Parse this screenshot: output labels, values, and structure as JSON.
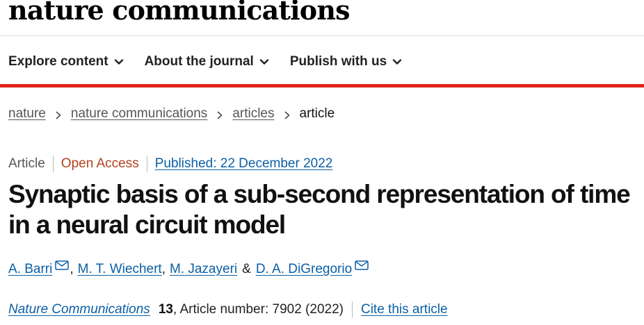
{
  "header": {
    "brand": "nature communications",
    "nav": [
      {
        "label": "Explore content"
      },
      {
        "label": "About the journal"
      },
      {
        "label": "Publish with us"
      }
    ]
  },
  "breadcrumb": {
    "items": [
      "nature",
      "nature communications",
      "articles"
    ],
    "current": "article"
  },
  "article": {
    "type": "Article",
    "access": "Open Access",
    "published": "Published: 22 December 2022",
    "title": "Synaptic basis of a sub-second representation of time in a neural circuit model",
    "authors": [
      "A. Barri",
      "M. T. Wiechert",
      "M. Jazayeri",
      "D. A. DiGregorio"
    ],
    "author_separator": ",",
    "author_and": "&",
    "citation": {
      "journal": "Nature Communications",
      "volume": "13",
      "rest": ", Article number: 7902 (2022)",
      "cite_label": "Cite this article"
    }
  },
  "colors": {
    "accent_red": "#e0251b",
    "link_blue": "#0b5fa5",
    "open_access": "#b4411c"
  },
  "icons": {
    "nav_chevron": "chevron-down-icon",
    "breadcrumb_separator": "chevron-right-icon",
    "author_contact": "mail-icon"
  }
}
